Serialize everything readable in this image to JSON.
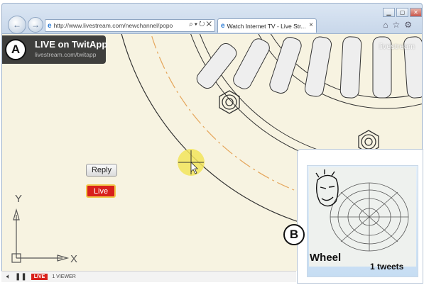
{
  "browser": {
    "url": "http://www.livestream.com/newchannel/popo",
    "tab_title": "Watch Internet TV - Live Str...",
    "tab_close": "×"
  },
  "overlay_a": {
    "marker": "A",
    "title": "LIVE on TwitApp",
    "subtitle": "livestream.com/twitapp"
  },
  "watermark": "livestream",
  "cad": {
    "axis_y": "Y",
    "axis_x": "X"
  },
  "player": {
    "live_badge": "LIVE",
    "viewers": "1 VIEWER"
  },
  "widget": {
    "marker": "B",
    "reply_label": "Reply",
    "live_label": "Live",
    "title": "Wheel",
    "tweets": "1 tweets"
  },
  "icons": {
    "back": "back-arrow-icon",
    "forward": "forward-arrow-icon",
    "browser": "ie-logo-icon",
    "search": "search-icon",
    "refresh": "refresh-icon",
    "stop": "stop-icon",
    "home": "home-icon",
    "favorites": "star-icon",
    "tools": "gear-icon",
    "volume": "speaker-icon",
    "pause": "pause-icon"
  },
  "colors": {
    "cad_background": "#f7f3e1",
    "center_line": "#e5a55a",
    "cursor_highlight": "#f2e45a",
    "live_red": "#d9211c"
  }
}
